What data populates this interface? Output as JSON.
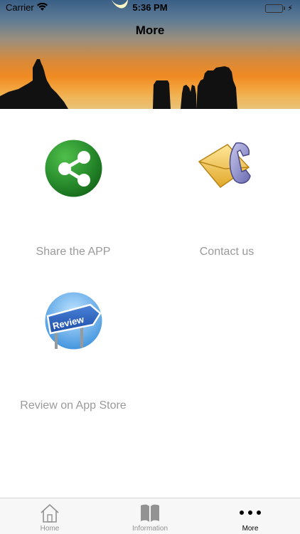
{
  "status_bar": {
    "carrier": "Carrier",
    "time": "5:36 PM",
    "battery_color": "#4cd964"
  },
  "nav": {
    "title": "More"
  },
  "items": [
    {
      "label": "Share the APP",
      "icon": "share-icon",
      "color": "#2f8f3a"
    },
    {
      "label": "Contact us",
      "icon": "envelope-phone-icon",
      "color": "#e9b83c"
    },
    {
      "label": "Review on App Store",
      "icon": "review-sign-icon",
      "color": "#2f6bbd"
    }
  ],
  "tabbar": {
    "tabs": [
      {
        "label": "Home",
        "icon": "home-icon",
        "active": false
      },
      {
        "label": "Information",
        "icon": "book-icon",
        "active": false
      },
      {
        "label": "More",
        "icon": "more-dots-icon",
        "active": true
      }
    ]
  }
}
